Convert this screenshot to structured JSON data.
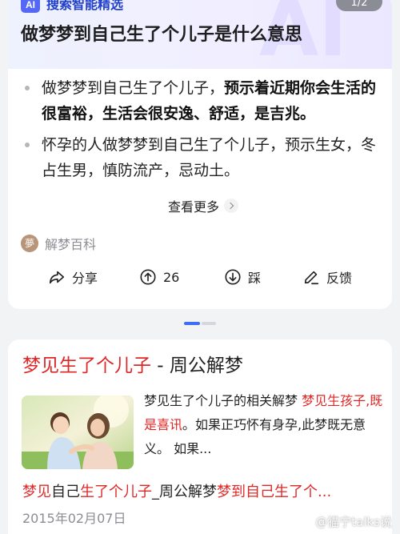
{
  "card1": {
    "badge": "AI",
    "source_label": "搜索智能精选",
    "page_indicator": "1/2",
    "title": "做梦梦到自己生了个儿子是什么意思",
    "bullets": [
      {
        "plain": "做梦梦到自己生了个儿子，",
        "bold": "预示着近期你会生活的很富裕，生活会很安逸、舒适，是吉兆。"
      },
      {
        "plain": "怀孕的人做梦梦到自己生了个儿子，预示生女，冬占生男，慎防流产，忌动土。",
        "bold": ""
      }
    ],
    "more_label": "查看更多",
    "source": {
      "avatar_char": "夢",
      "name": "解梦百科"
    },
    "actions": {
      "share": "分享",
      "upvote": "26",
      "downvote": "踩",
      "feedback": "反馈"
    }
  },
  "carousel": {
    "active_index": 0,
    "count": 2
  },
  "card2": {
    "title_red": "梦见生了个儿子",
    "title_rest": " - 周公解梦",
    "snippet_plain1": "梦见生了个儿子的相关解梦 ",
    "snippet_red": "梦见生孩子,既是喜讯",
    "snippet_plain2": "。如果正巧怀有身孕,此梦既无意义。 如果...",
    "related_parts": [
      {
        "text": "梦见",
        "red": true
      },
      {
        "text": "自己",
        "red": false
      },
      {
        "text": "生了个儿子",
        "red": true
      },
      {
        "text": "_周公解梦",
        "red": false
      },
      {
        "text": "梦到自己生了个...",
        "red": true
      }
    ],
    "date": "2015年02月07日"
  },
  "watermark": "@猫宁talks说",
  "colors": {
    "accent_blue": "#3b6ef5",
    "title_red": "#e02727",
    "head_blue": "#1f3fcc"
  }
}
